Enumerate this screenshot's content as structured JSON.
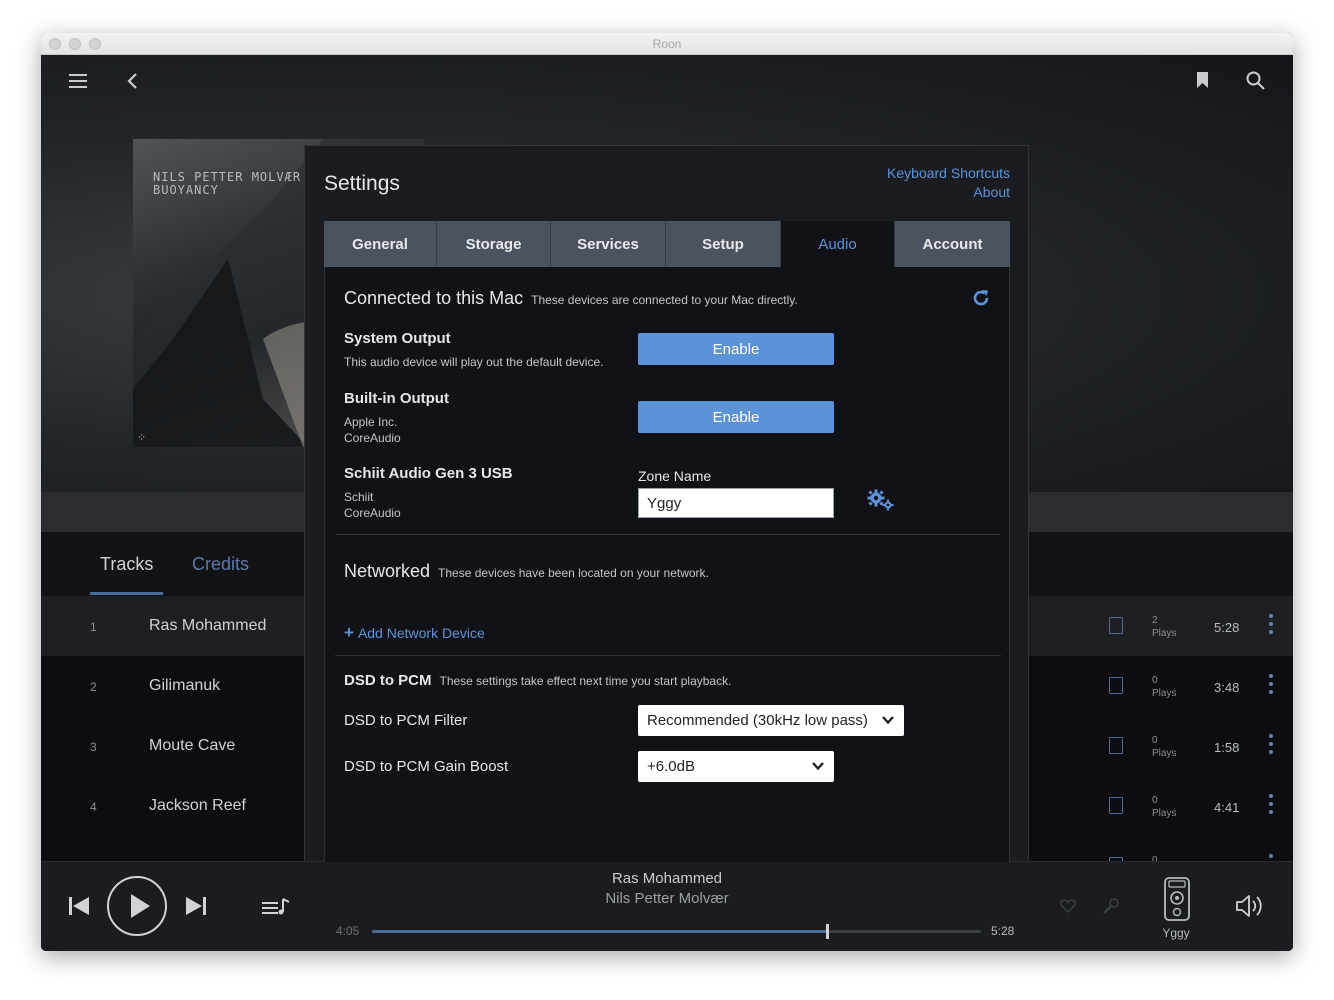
{
  "window": {
    "title": "Roon"
  },
  "album": {
    "cover_line1": "NILS PETTER MOLVÆR",
    "cover_line2": "BUOYANCY",
    "cover_mark": "⁘"
  },
  "track_tabs": {
    "tracks": "Tracks",
    "credits": "Credits"
  },
  "tracks": [
    {
      "num": "1",
      "name": "Ras Mohammed",
      "plays_count": "2",
      "plays_label": "Plays",
      "duration": "5:28"
    },
    {
      "num": "2",
      "name": "Gilimanuk",
      "plays_count": "0",
      "plays_label": "Plays",
      "duration": "3:48"
    },
    {
      "num": "3",
      "name": "Moute Cave",
      "plays_count": "0",
      "plays_label": "Plays",
      "duration": "1:58"
    },
    {
      "num": "4",
      "name": "Jackson Reef",
      "plays_count": "0",
      "plays_label": "Plays",
      "duration": "4:41"
    },
    {
      "num": "",
      "name": "",
      "plays_count": "0",
      "plays_label": "",
      "duration": ""
    }
  ],
  "settings": {
    "title": "Settings",
    "links": {
      "keyboard_shortcuts": "Keyboard Shortcuts",
      "about": "About"
    },
    "tabs": [
      "General",
      "Storage",
      "Services",
      "Setup",
      "Audio",
      "Account"
    ],
    "active_tab": "Audio",
    "connected": {
      "title": "Connected to this Mac",
      "description": "These devices are connected to your Mac directly.",
      "devices": [
        {
          "name": "System Output",
          "sub1": "This audio device will play out the default device.",
          "sub2": "",
          "action": "Enable"
        },
        {
          "name": "Built-in Output",
          "sub1": "Apple Inc.",
          "sub2": "CoreAudio",
          "action": "Enable"
        },
        {
          "name": "Schiit Audio Gen 3 USB",
          "sub1": "Schiit",
          "sub2": "CoreAudio",
          "zone_caption": "Zone Name",
          "zone_value": "Yggy"
        }
      ]
    },
    "networked": {
      "title": "Networked",
      "description": "These devices have been located on your network.",
      "add_label": "Add Network Device"
    },
    "dsd": {
      "title": "DSD to PCM",
      "description": "These settings take effect next time you start playback.",
      "filter_label": "DSD to PCM Filter",
      "filter_value": "Recommended (30kHz low pass)",
      "gain_label": "DSD to PCM Gain Boost",
      "gain_value": "+6.0dB"
    }
  },
  "now_playing": {
    "title": "Ras Mohammed",
    "artist": "Nils Petter Molvær",
    "elapsed": "4:05",
    "total": "5:28",
    "progress": 0.747,
    "zone": "Yggy"
  },
  "colors": {
    "accent": "#5d93d6",
    "button": "#5b93d8",
    "panel": "#111217",
    "tabbar": "#4b5361"
  }
}
